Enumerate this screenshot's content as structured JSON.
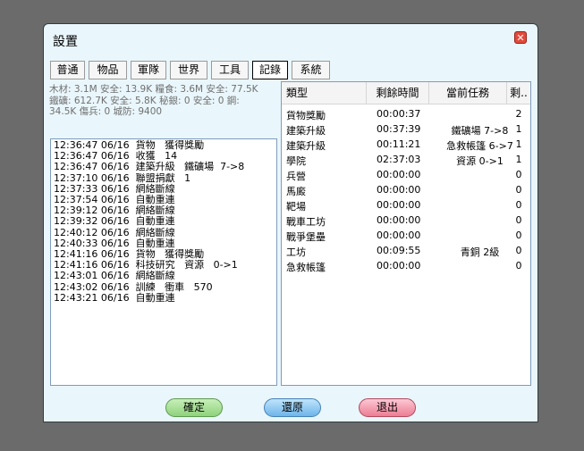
{
  "window": {
    "title": "設置",
    "close_icon": "close-icon"
  },
  "tabs": [
    "普通",
    "物品",
    "軍隊",
    "世界",
    "工具",
    "記錄",
    "系統"
  ],
  "resources": {
    "line1": "木材: 3.1M 安全: 13.9K  糧食: 3.6M 安全: 77.5K",
    "line2": "鐵礦: 612.7K 安全: 5.8K  秘銀: 0 安全: 0  鋼:",
    "line3": "34.5K  傷兵: 0  城防: 9400"
  },
  "log": [
    "12:36:47 06/16  貨物   獲得獎勵",
    "12:36:47 06/16  收獲   14",
    "12:36:47 06/16  建築升級   鐵礦場  7->8",
    "12:37:10 06/16  聯盟捐獻   1",
    "12:37:33 06/16  網絡斷線",
    "12:37:54 06/16  自動重連",
    "12:39:12 06/16  網絡斷線",
    "12:39:32 06/16  自動重連",
    "12:40:12 06/16  網絡斷線",
    "12:40:33 06/16  自動重連",
    "12:41:16 06/16  貨物   獲得獎勵",
    "12:41:16 06/16  科技研究   資源   0->1",
    "12:43:01 06/16  網絡斷線",
    "12:43:02 06/16  訓練   衝車   570",
    "12:43:21 06/16  自動重連"
  ],
  "table": {
    "headers": [
      "類型",
      "剩餘時間",
      "當前任務",
      "剩.."
    ],
    "rows": [
      {
        "type": "貨物獎勵",
        "time": "00:00:37",
        "task": "",
        "n": "2"
      },
      {
        "type": "建築升級",
        "time": "00:37:39",
        "task": "鐵礦場 7->8",
        "n": "1"
      },
      {
        "type": "建築升級",
        "time": "00:11:21",
        "task": "急救帳篷 6->7",
        "n": "1"
      },
      {
        "type": "學院",
        "time": "02:37:03",
        "task": "資源 0->1",
        "n": "1"
      },
      {
        "type": "兵營",
        "time": "00:00:00",
        "task": "",
        "n": "0"
      },
      {
        "type": "馬廄",
        "time": "00:00:00",
        "task": "",
        "n": "0"
      },
      {
        "type": "靶場",
        "time": "00:00:00",
        "task": "",
        "n": "0"
      },
      {
        "type": "戰車工坊",
        "time": "00:00:00",
        "task": "",
        "n": "0"
      },
      {
        "type": "戰爭堡壘",
        "time": "00:00:00",
        "task": "",
        "n": "0"
      },
      {
        "type": "工坊",
        "time": "00:09:55",
        "task": "青銅 2級",
        "n": "0"
      },
      {
        "type": "急救帳篷",
        "time": "00:00:00",
        "task": "",
        "n": "0"
      }
    ]
  },
  "buttons": {
    "ok": "確定",
    "reset": "還原",
    "exit": "退出"
  }
}
